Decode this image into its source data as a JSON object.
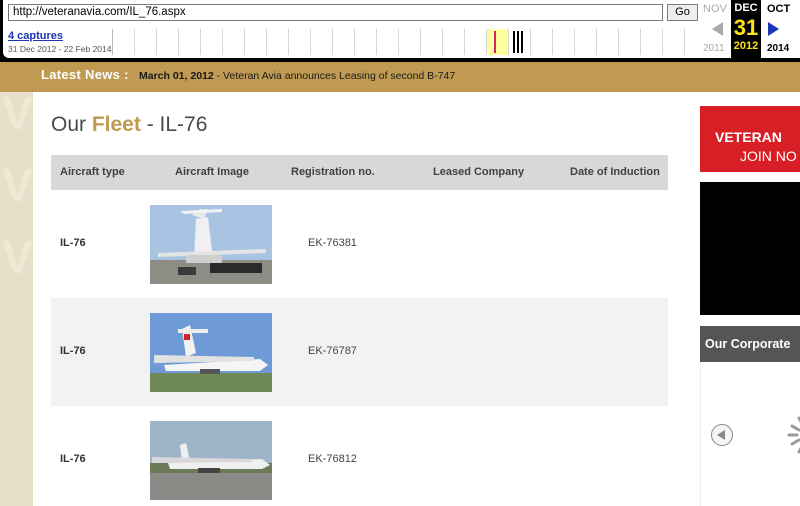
{
  "wayback": {
    "url": "http://veteranavia.com/IL_76.aspx",
    "go_label": "Go",
    "captures_label": "4 captures",
    "capture_range": "31 Dec 2012 - 22 Feb 2014",
    "prev_month": "NOV",
    "prev_year": "2011",
    "current_month": "DEC",
    "current_day": "31",
    "current_year": "2012",
    "next_month": "OCT",
    "next_year": "2014",
    "highlight_color": "#ffffa0",
    "mark_color": "#d81f6a"
  },
  "news": {
    "label": "Latest News :",
    "date": "March 01, 2012",
    "text": " - Veteran Avia announces Leasing of second B-747"
  },
  "page": {
    "title_prefix": "Our ",
    "title_accent": "Fleet",
    "title_suffix": " - IL-76"
  },
  "table": {
    "headers": [
      "Aircraft type",
      "Aircraft Image",
      "Registration no.",
      "Leased Company",
      "Date of Induction"
    ],
    "rows": [
      {
        "type": "IL-76",
        "registration": "EK-76381",
        "leased_company": "",
        "date_of_induction": ""
      },
      {
        "type": "IL-76",
        "registration": "EK-76787",
        "leased_company": "",
        "date_of_induction": ""
      },
      {
        "type": "IL-76",
        "registration": "EK-76812",
        "leased_company": "",
        "date_of_induction": ""
      }
    ]
  },
  "sidebar": {
    "ad_line1": "VETERAN",
    "ad_line2": "JOIN NO",
    "corporate_title": "Our Corporate"
  },
  "colors": {
    "accent_gold": "#c09a52",
    "ad_red": "#d81f26"
  }
}
